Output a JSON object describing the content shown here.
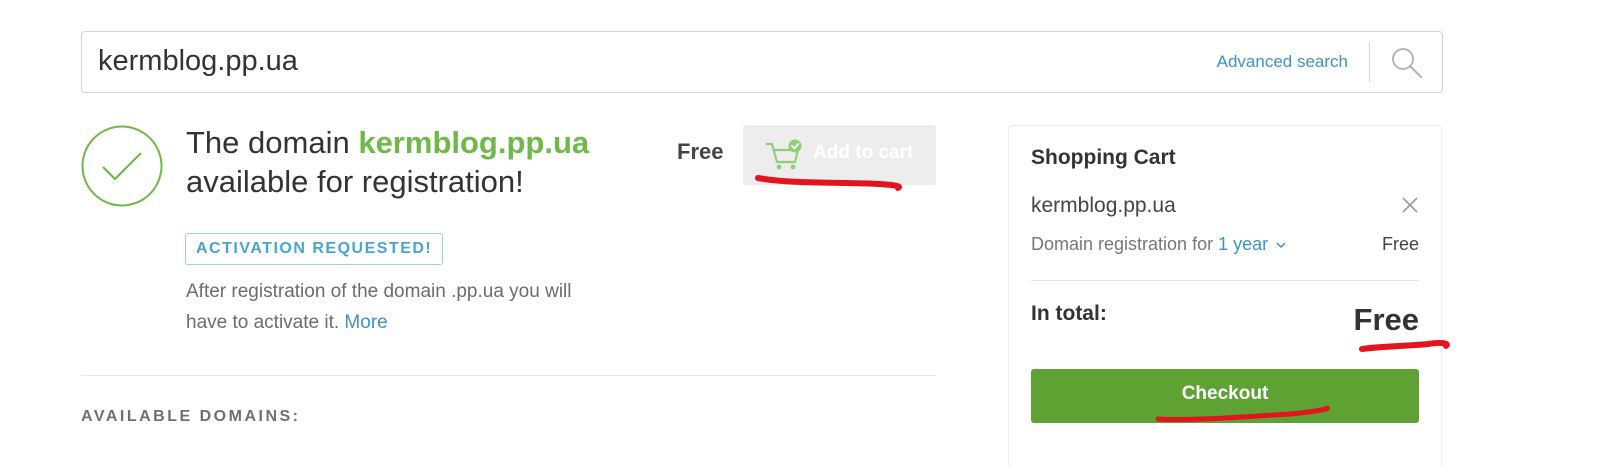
{
  "search": {
    "value": "kermblog.pp.ua",
    "advanced_link": "Advanced search",
    "icon": "search-icon"
  },
  "result": {
    "headline_prefix": "The domain ",
    "domain": "kermblog.pp.ua",
    "headline_suffix": "available for registration!",
    "price": "Free",
    "add_to_cart_label": "Add to cart",
    "badge": "ACTIVATION REQUESTED!",
    "activation_text": "After registration of the domain .pp.ua you will have to activate it. ",
    "more_link": "More"
  },
  "available_domains_heading": "AVAILABLE DOMAINS:",
  "cart": {
    "title": "Shopping Cart",
    "item_name": "kermblog.pp.ua",
    "registration_label": "Domain registration for ",
    "period": "1 year",
    "item_price": "Free",
    "total_label": "In total:",
    "total_value": "Free",
    "checkout_label": "Checkout"
  },
  "colors": {
    "accent_green": "#6fb84a",
    "checkout_green": "#5ea234",
    "link_blue": "#3f93c3",
    "annotation_red": "#e3141d"
  }
}
